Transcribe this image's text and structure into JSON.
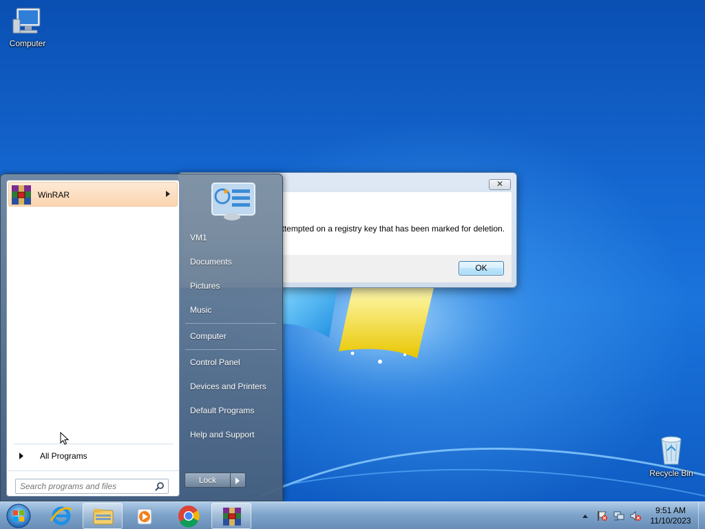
{
  "desktop": {
    "icons": [
      {
        "label": "Computer"
      },
      {
        "label": "Recycle Bin"
      }
    ]
  },
  "dialog": {
    "close_label": "✕",
    "message": "ttempted on a registry key that has been marked for deletion.",
    "ok_label": "OK"
  },
  "start_menu": {
    "pinned": [
      {
        "label": "WinRAR",
        "icon": "winrar-icon"
      }
    ],
    "all_programs_label": "All Programs",
    "search_placeholder": "Search programs and files",
    "right_links": [
      "VM1",
      "Documents",
      "Pictures",
      "Music",
      "Computer",
      "Control Panel",
      "Devices and Printers",
      "Default Programs",
      "Help and Support"
    ],
    "lock_label": "Lock"
  },
  "taskbar": {
    "apps": [
      "start-orb",
      "internet-explorer-icon",
      "file-explorer-icon",
      "media-player-icon",
      "chrome-icon",
      "winrar-icon"
    ],
    "clock_time": "9:51 AM",
    "clock_date": "11/10/2023"
  },
  "colors": {
    "desktop_blue": "#1466cf",
    "highlight_orange": "#fbd5b0",
    "start_menu_panel": "#6f849b"
  }
}
